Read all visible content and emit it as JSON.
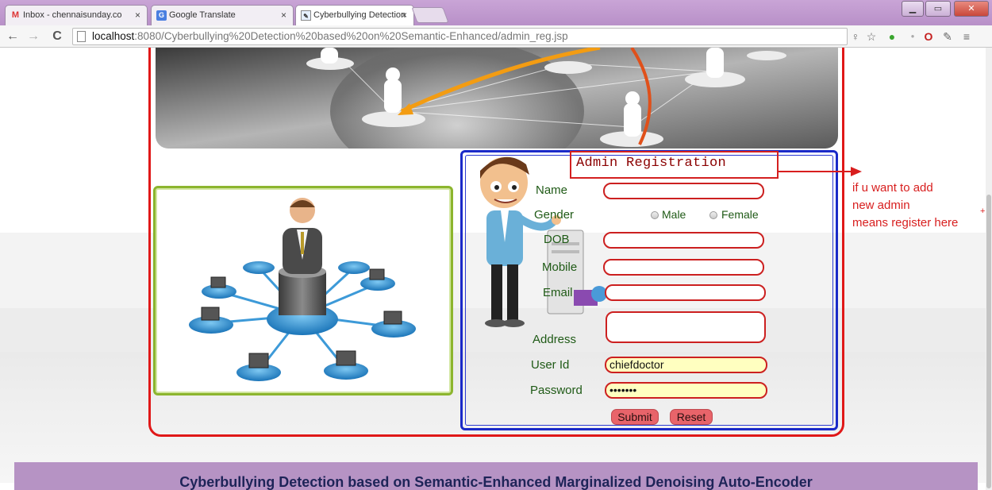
{
  "browser": {
    "tabs": [
      {
        "title": "Inbox - chennaisunday.co",
        "icon": "gmail-icon"
      },
      {
        "title": "Google Translate",
        "icon": "translate-icon"
      },
      {
        "title": "Cyberbullying Detection",
        "icon": "page-icon"
      }
    ],
    "tab_close_glyph": "×",
    "url_host": "localhost",
    "url_path": ":8080/Cyberbullying%20Detection%20based%20on%20Semantic-Enhanced/admin_reg.jsp",
    "window_buttons": [
      "minimize",
      "maximize",
      "close"
    ]
  },
  "form": {
    "title": "Admin Registration",
    "labels": {
      "name": "Name",
      "gender": "Gender",
      "dob": "DOB",
      "mobile": "Mobile",
      "email": "Email",
      "address": "Address",
      "userid": "User Id",
      "password": "Password"
    },
    "gender_options": [
      "Male",
      "Female"
    ],
    "values": {
      "name": "",
      "dob": "",
      "mobile": "",
      "email": "",
      "address": "",
      "userid": "chiefdoctor",
      "password": "•••••••"
    },
    "buttons": {
      "submit": "Submit",
      "reset": "Reset"
    }
  },
  "annotation": {
    "lines": [
      "if u want to add",
      "new admin",
      "means register here"
    ],
    "plus": "+"
  },
  "footer": {
    "title": "Cyberbullying Detection based on Semantic-Enhanced Marginalized Denoising Auto-Encoder"
  },
  "colors": {
    "frame": "#e01818",
    "form_border": "#1a2ac8",
    "footer_bg": "#b693c4",
    "label_green": "#1f5a16"
  }
}
